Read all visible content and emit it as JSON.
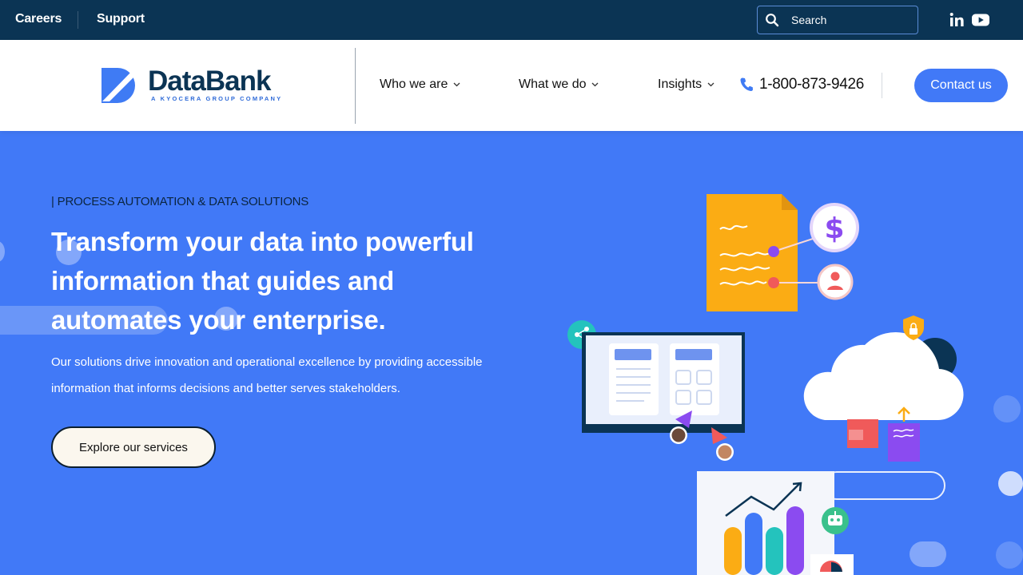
{
  "topbar": {
    "careers": "Careers",
    "support": "Support",
    "search_placeholder": "Search",
    "social": [
      "linkedin-icon",
      "youtube-icon"
    ]
  },
  "header": {
    "logo_name": "DataBank",
    "logo_tagline": "A KYOCERA GROUP COMPANY",
    "nav": [
      "Who we are",
      "What we do",
      "Insights"
    ],
    "phone": "1-800-873-9426",
    "contact": "Contact us"
  },
  "hero": {
    "eyebrow": "| PROCESS AUTOMATION & DATA SOLUTIONS",
    "headline": "Transform your data into powerful information that guides and automates your enterprise.",
    "description": "Our solutions drive innovation and operational excellence by providing accessible information that informs decisions and better serves stakeholders.",
    "cta": "Explore our services"
  },
  "colors": {
    "topbar": "#0b3454",
    "hero": "#4179f7",
    "accent": "#4179f7",
    "navy": "#0b3454"
  }
}
